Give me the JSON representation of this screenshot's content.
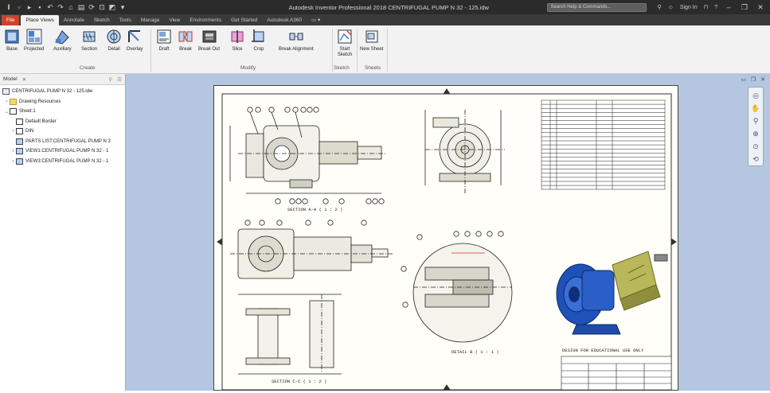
{
  "titlebar": {
    "app_title": "Autodesk Inventor Professional 2018   CENTRIFUGAL PUMP N 32 - 125.idw",
    "search_placeholder": "Search Help & Commands...",
    "sign_in": "Sign In"
  },
  "tabs": [
    "File",
    "Place Views",
    "Annotate",
    "Sketch",
    "Tools",
    "Manage",
    "View",
    "Environments",
    "Get Started",
    "Autodesk A360"
  ],
  "ribbon": {
    "create": {
      "label": "Create",
      "buttons": [
        "Base",
        "Projected",
        "Auxiliary",
        "Section",
        "Detail",
        "Overlay"
      ]
    },
    "modify": {
      "label": "Modify",
      "buttons": [
        "Draft",
        "Break",
        "Break Out",
        "Slice",
        "Crop",
        "Break Alignment"
      ]
    },
    "sketch": {
      "label": "Sketch",
      "button": "Start Sketch"
    },
    "sheets": {
      "label": "Sheets",
      "button": "New Sheet"
    }
  },
  "browser": {
    "tab_label": "Model",
    "tree": [
      {
        "label": "CENTRIFUGAL PUMP N 32 - 125.idw",
        "icon": "drawing-icon"
      },
      {
        "label": "Drawing Resources",
        "icon": "folder-icon"
      },
      {
        "label": "Sheet:1",
        "icon": "sheet-icon"
      },
      {
        "label": "Default Border",
        "icon": "border-icon"
      },
      {
        "label": "DIN",
        "icon": "title-block-icon"
      },
      {
        "label": "PARTS LIST:CENTRIFUGAL PUMP N 3",
        "icon": "parts-list-icon"
      },
      {
        "label": "VIEW1:CENTRIFUGAL PUMP N 32 - 1",
        "icon": "view-icon"
      },
      {
        "label": "VIEW3:CENTRIFUGAL PUMP N 32 - 1",
        "icon": "view-icon"
      }
    ]
  },
  "drawing": {
    "section_label": "SECTION A-A ( 1 : 2 )",
    "section_label_2": "SECTION C-C ( 1 : 2 )",
    "detail_label": "DETAIL B ( 1 : 1 )",
    "note": "DESIGN FOR EDUCATIONAL USE ONLY"
  },
  "colors": {
    "titlebar": "#2b2b2b",
    "file_tab": "#c8452a",
    "canvas_bg": "#b4c6e0",
    "pump_body": "#1f52b8",
    "motor": "#b8b85a"
  }
}
